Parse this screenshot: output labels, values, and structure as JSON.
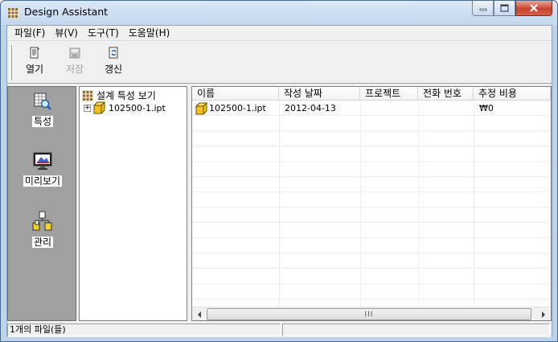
{
  "window": {
    "title": "Design Assistant",
    "icon": "design-assistant-app-icon",
    "controls": {
      "minimize_icon": "minimize-icon",
      "maximize_icon": "maximize-icon",
      "close_icon": "close-icon"
    }
  },
  "menu": {
    "items": [
      {
        "label": "파일(F)"
      },
      {
        "label": "뷰(V)"
      },
      {
        "label": "도구(T)"
      },
      {
        "label": "도움말(H)"
      }
    ]
  },
  "toolbar": {
    "open_label": "열기",
    "save_label": "저장",
    "refresh_label": "갱신",
    "save_disabled": true
  },
  "leftnav": {
    "items": [
      {
        "label": "특성",
        "icon": "properties-icon"
      },
      {
        "label": "미리보기",
        "icon": "preview-icon"
      },
      {
        "label": "관리",
        "icon": "manage-icon"
      }
    ]
  },
  "tree": {
    "root_label": "설계 특성 보기",
    "children": [
      {
        "label": "102500-1.ipt",
        "expander": "+"
      }
    ]
  },
  "list": {
    "columns": [
      "이름",
      "작성 날짜",
      "프로젝트",
      "전화 번호",
      "추정 비용"
    ],
    "rows": [
      {
        "name": "102500-1.ipt",
        "created": "2012-04-13",
        "project": "",
        "phone": "",
        "cost": "₩0"
      }
    ],
    "scroll_thumb_grip": "III"
  },
  "status": {
    "text": "1개의 파일(들)"
  },
  "colors": {
    "nav_background": "#a0a0a0",
    "titlebar": "#c3d7ee",
    "close_button": "#c8442c"
  }
}
